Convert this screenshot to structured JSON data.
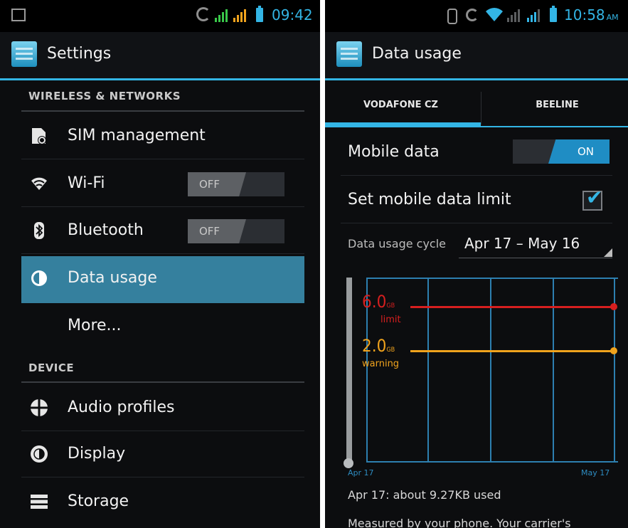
{
  "left": {
    "status": {
      "time": "09:42"
    },
    "title": "Settings",
    "sections": [
      {
        "header": "WIRELESS & NETWORKS"
      },
      {
        "header": "DEVICE"
      }
    ],
    "items": {
      "sim": "SIM management",
      "wifi": "Wi-Fi",
      "wifi_state": "OFF",
      "bluetooth": "Bluetooth",
      "bluetooth_state": "OFF",
      "data_usage": "Data usage",
      "more": "More...",
      "audio": "Audio profiles",
      "display": "Display",
      "storage": "Storage"
    }
  },
  "right": {
    "status": {
      "time": "10:58",
      "ampm": "AM"
    },
    "title": "Data usage",
    "tabs": [
      {
        "label": "VODAFONE CZ",
        "selected": true
      },
      {
        "label": "BEELINE",
        "selected": false
      }
    ],
    "mobile_data": {
      "label": "Mobile data",
      "state": "ON"
    },
    "set_limit": {
      "label": "Set mobile data limit",
      "checked": true
    },
    "cycle": {
      "label": "Data usage cycle",
      "value": "Apr 17 – May 16"
    },
    "graph": {
      "limit": {
        "value": "6.0",
        "unit": "GB",
        "label": "limit",
        "color": "#d61f1f"
      },
      "warning": {
        "value": "2.0",
        "unit": "GB",
        "label": "warning",
        "color": "#f0a31d"
      },
      "start_label": "Apr 17",
      "end_label": "May 17"
    },
    "summary": "Apr 17: about 9.27KB used",
    "measured": "Measured by your phone. Your carrier's"
  },
  "colors": {
    "accent": "#33b5e5",
    "selected_row": "#35809e",
    "signal": "#39c84a"
  }
}
